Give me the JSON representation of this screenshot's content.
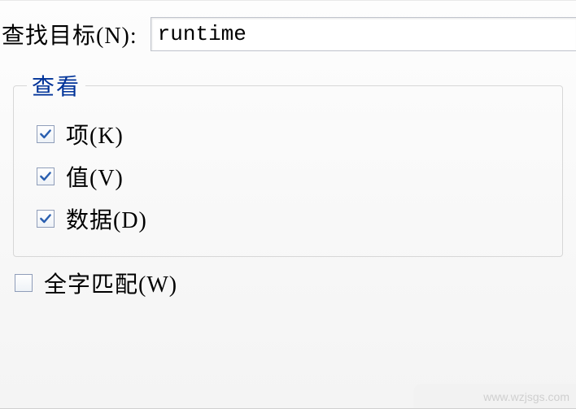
{
  "search": {
    "label": "查找目标(N):",
    "value": "runtime"
  },
  "view_group": {
    "legend": "查看",
    "options": [
      {
        "label": "项(K)",
        "checked": true
      },
      {
        "label": "值(V)",
        "checked": true
      },
      {
        "label": "数据(D)",
        "checked": true
      }
    ]
  },
  "whole_word": {
    "label": "全字匹配(W)",
    "checked": false
  },
  "watermark": "www.wzjsgs.com"
}
